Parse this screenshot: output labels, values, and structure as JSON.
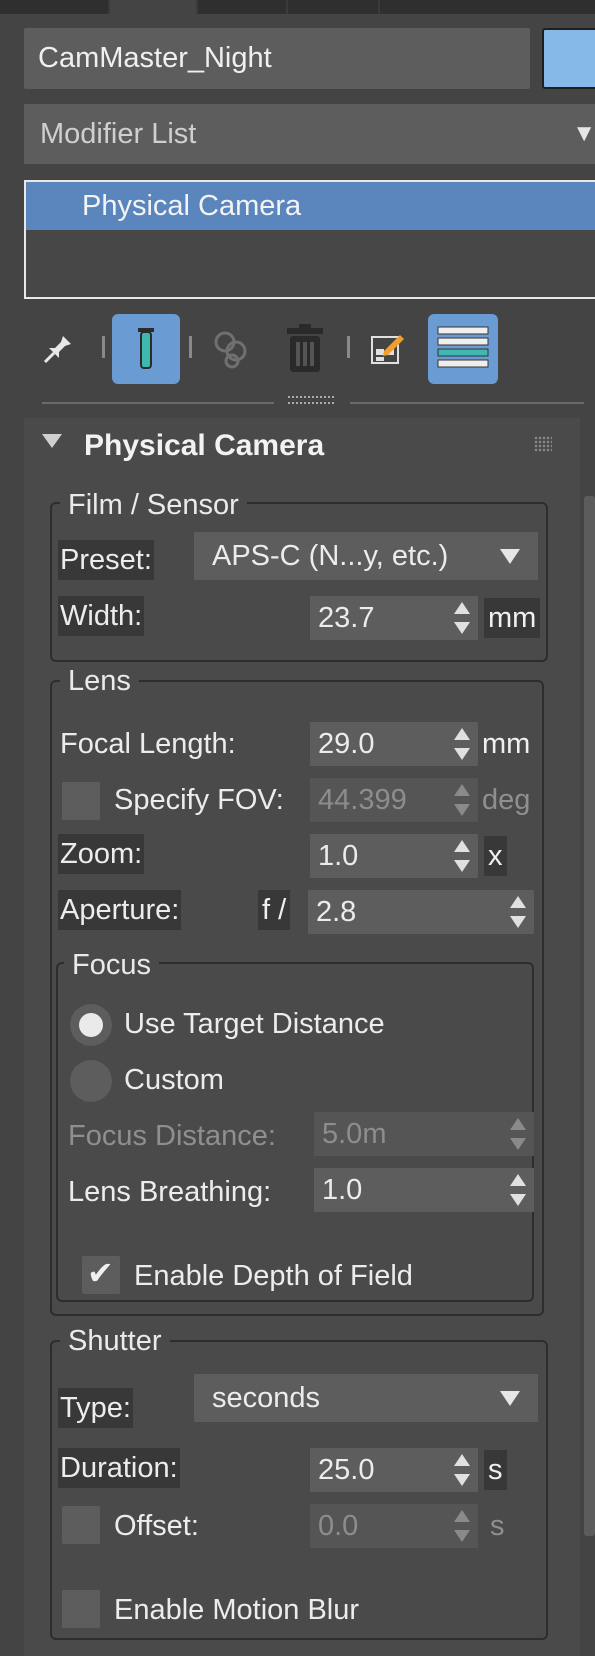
{
  "object": {
    "name": "CamMaster_Night",
    "color": "#86b8e8"
  },
  "modifier_list": {
    "label": "Modifier List"
  },
  "stack": {
    "items": [
      "Physical Camera"
    ]
  },
  "toolbar": {
    "icons": [
      "pin-stack-icon",
      "show-end-result-icon",
      "make-unique-icon",
      "remove-modifier-icon",
      "configure-modifier-sets-icon",
      "stack-list-icon"
    ]
  },
  "rollout": {
    "title": "Physical Camera",
    "film_sensor": {
      "group_label": "Film / Sensor",
      "preset_label": "Preset:",
      "preset_value": "APS-C (N...y, etc.)",
      "width_label": "Width:",
      "width_value": "23.7",
      "width_unit": "mm"
    },
    "lens": {
      "group_label": "Lens",
      "focal_length_label": "Focal Length:",
      "focal_length_value": "29.0",
      "focal_length_unit": "mm",
      "specify_fov_label": "Specify FOV:",
      "specify_fov_checked": false,
      "fov_value": "44.399",
      "fov_unit": "deg",
      "zoom_label": "Zoom:",
      "zoom_value": "1.0",
      "zoom_unit": "x",
      "aperture_label": "Aperture:",
      "aperture_prefix": "f /",
      "aperture_value": "2.8"
    },
    "focus": {
      "group_label": "Focus",
      "use_target_label": "Use Target Distance",
      "use_target_selected": true,
      "custom_label": "Custom",
      "custom_selected": false,
      "focus_distance_label": "Focus Distance:",
      "focus_distance_value": "5.0m",
      "lens_breathing_label": "Lens Breathing:",
      "lens_breathing_value": "1.0",
      "dof_label": "Enable Depth of Field",
      "dof_checked": true
    },
    "shutter": {
      "group_label": "Shutter",
      "type_label": "Type:",
      "type_value": "seconds",
      "duration_label": "Duration:",
      "duration_value": "25.0",
      "duration_unit": "s",
      "offset_label": "Offset:",
      "offset_checked": false,
      "offset_value": "0.0",
      "offset_unit": "s",
      "motion_blur_label": "Enable Motion Blur",
      "motion_blur_checked": false
    }
  }
}
